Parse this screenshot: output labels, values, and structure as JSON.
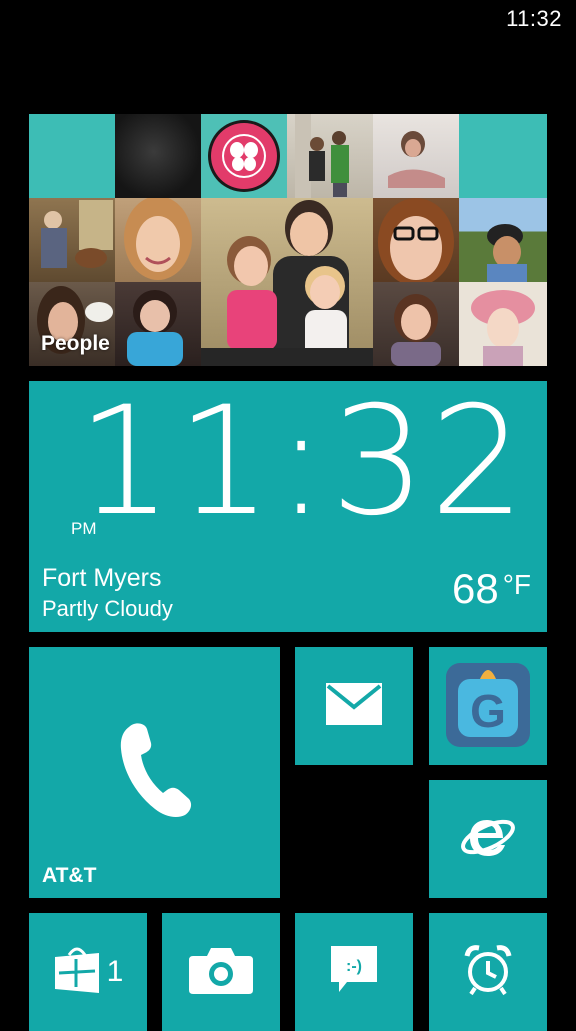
{
  "status_bar": {
    "time": "11:32"
  },
  "people_tile": {
    "label": "People"
  },
  "clock_tile": {
    "time": "11:32",
    "ampm": "PM",
    "city": "Fort Myers",
    "condition": "Partly Cloudy",
    "temperature": "68",
    "unit": "°F"
  },
  "phone_tile": {
    "label": "AT&T",
    "icon": "phone-icon"
  },
  "mail_tile": {
    "icon": "mail-icon"
  },
  "app_tile": {
    "icon": "g-app-icon",
    "letter": "G"
  },
  "ie_tile": {
    "icon": "internet-explorer-icon"
  },
  "store_tile": {
    "icon": "store-icon",
    "count": "1"
  },
  "camera_tile": {
    "icon": "camera-icon"
  },
  "messaging_tile": {
    "icon": "messaging-icon",
    "glyph": ":-)"
  },
  "alarm_tile": {
    "icon": "alarm-clock-icon"
  },
  "colors": {
    "accent": "#13a8a8",
    "background": "#000000"
  }
}
